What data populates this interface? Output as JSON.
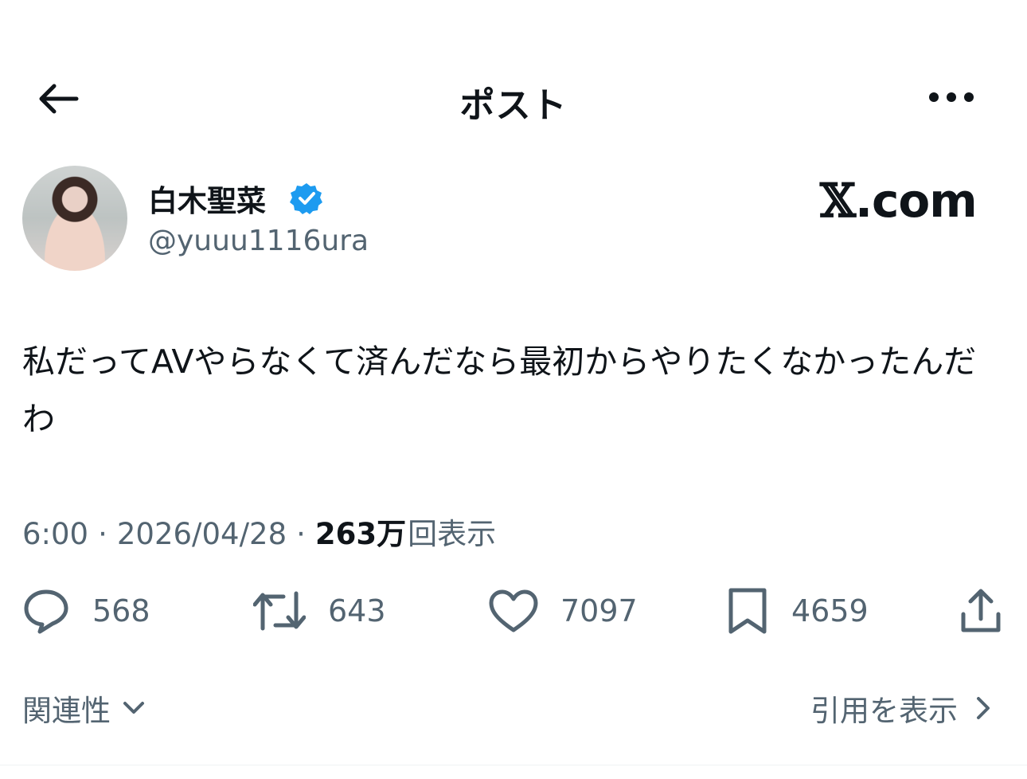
{
  "header": {
    "title": "ポスト",
    "back_icon": "arrow-left-icon",
    "more_icon": "more-horizontal-icon"
  },
  "author": {
    "display_name": "白木聖菜",
    "handle": "@yuuu1116ura",
    "verified": true,
    "verified_color": "#1d9bf0"
  },
  "brand": {
    "x_glyph": "𝕏",
    "suffix": ".com"
  },
  "post": {
    "text": "私だってAVやらなくて済んだなら最初からやりたくなかったんだわ"
  },
  "meta": {
    "time": "6:00",
    "separator": "·",
    "date": "2026/04/28",
    "views_number": "263万",
    "views_label": "回表示"
  },
  "actions": {
    "reply_count": "568",
    "repost_count": "643",
    "like_count": "7097",
    "bookmark_count": "4659"
  },
  "footer": {
    "sort_label": "関連性",
    "quotes_label": "引用を表示"
  },
  "colors": {
    "text_primary": "#0f1419",
    "text_secondary": "#536471",
    "accent": "#1d9bf0"
  }
}
